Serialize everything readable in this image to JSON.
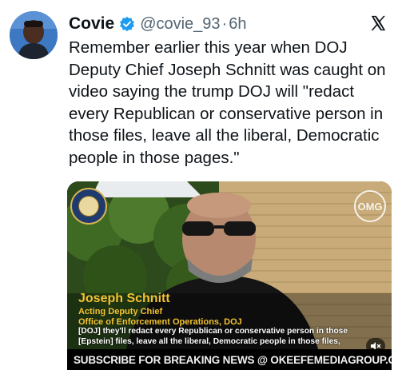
{
  "author": {
    "name": "Covie",
    "handle": "@covie_93",
    "separator": "·",
    "time": "6h",
    "verified_color": "#1d9bf0"
  },
  "tweet": {
    "text": "Remember earlier this year when DOJ Deputy Chief Joseph Schnitt was caught on video saying the trump DOJ will \"redact every Republican or conservative person in those files, leave all the liberal, Democratic people in those pages.\""
  },
  "media": {
    "caption_name": "Joseph Schnitt",
    "caption_title": "Acting Deputy Chief",
    "caption_office": "Office of Enforcement Operations, DOJ",
    "subtitle": "[DOJ] they'll redact every Republican or conservative person in those [Epstein] files, leave all the liberal, Democratic people in those files,",
    "banner": "SUBSCRIBE FOR BREAKING NEWS @ OKEEFEMEDIAGROUP.COM",
    "watermark_icon": "omg-logo-icon",
    "caption_color": "#f2c230"
  },
  "icons": {
    "verified": "verified-badge-icon",
    "x_logo": "x-logo-icon",
    "mute": "mute-icon"
  }
}
